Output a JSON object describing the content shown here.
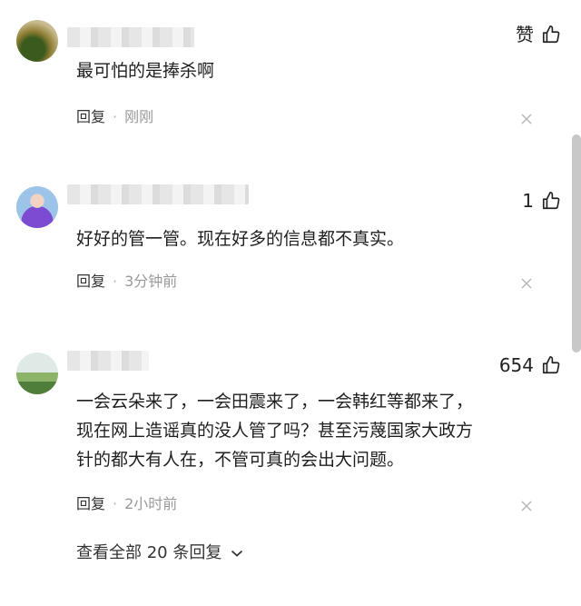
{
  "comments": [
    {
      "like_label": "赞",
      "text": "最可怕的是捧杀啊",
      "reply_label": "回复",
      "time": "刚刚"
    },
    {
      "like_label": "1",
      "text": "好好的管一管。现在好多的信息都不真实。",
      "reply_label": "回复",
      "time": "3分钟前"
    },
    {
      "like_label": "654",
      "text": "一会云朵来了，一会田震来了，一会韩红等都来了，\n现在网上造谣真的没人管了吗？甚至污蔑国家大政方\n针的都大有人在，不管可真的会出大问题。",
      "reply_label": "回复",
      "time": "2小时前"
    }
  ],
  "view_all": "查看全部 20 条回复",
  "icons": {
    "like": "thumbs-up-icon",
    "close": "close-icon",
    "expand": "chevron-down-icon"
  }
}
